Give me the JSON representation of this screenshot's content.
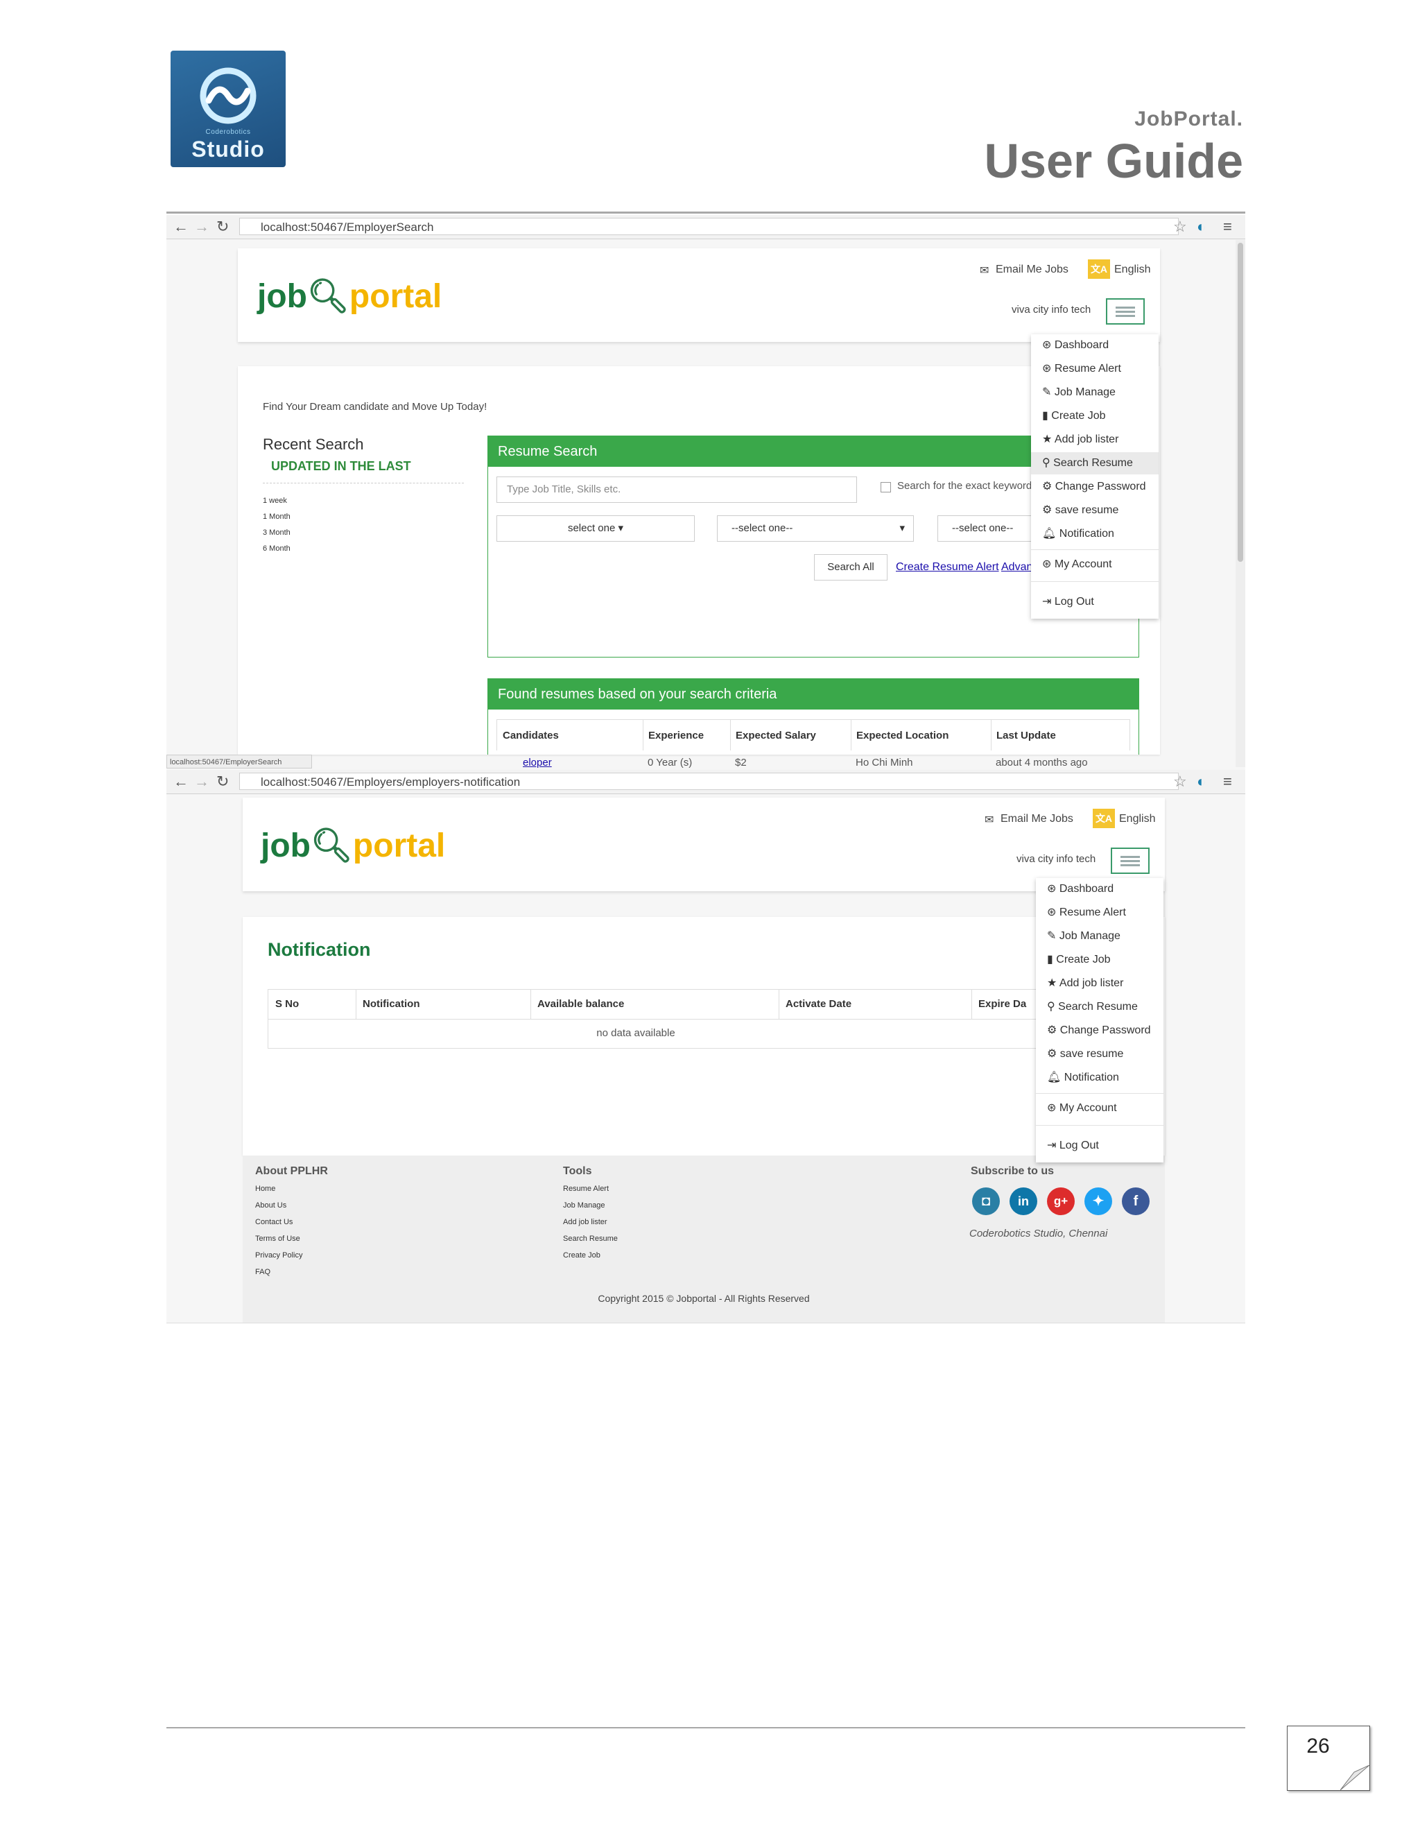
{
  "doc": {
    "logo_small_text": "Coderobotics",
    "logo_studio_text": "Studio",
    "kicker": "JobPortal.",
    "title": "User Guide",
    "page_number": "26"
  },
  "shot1": {
    "url": "localhost:50467/EmployerSearch",
    "status_url": "localhost:50467/EmployerSearch",
    "email_me_jobs": "Email Me Jobs",
    "language": "English",
    "user": "viva city info tech",
    "brand_job": "job",
    "brand_portal": "portal",
    "tagline": "Find Your Dream candidate and Move Up Today!",
    "recent_search_title": "Recent Search",
    "updated_label": "UPDATED IN THE LAST",
    "periods": [
      "1 week",
      "1 Month",
      "3 Month",
      "6 Month"
    ],
    "resume_search_title": "Resume Search",
    "search_placeholder": "Type Job Title, Skills etc.",
    "exact_keyword_label": "Search for the exact keyword",
    "select1": "select one",
    "select2": "--select one--",
    "select3": "--select one--",
    "search_all": "Search All",
    "create_alert_link": "Create Resume Alert",
    "advanced_link": "Advanced",
    "found_title": "Found resumes based on your search criteria",
    "table_headers": [
      "Candidates",
      "Experience",
      "Expected Salary",
      "Expected Location",
      "Last Update"
    ],
    "row": [
      "eloper",
      "0 Year (s)",
      "$2",
      "Ho Chi Minh",
      "about 4 months ago"
    ]
  },
  "menu": {
    "items": [
      "Dashboard",
      "Resume Alert",
      "Job Manage",
      "Create Job",
      "Add job lister",
      "Search Resume",
      "Change Password",
      "save resume",
      "Notification"
    ],
    "my_account": "My Account",
    "log_out": "Log Out",
    "active_index": 5
  },
  "shot2": {
    "url": "localhost:50467/Employers/employers-notification",
    "email_me_jobs": "Email Me Jobs",
    "language": "English",
    "user": "viva city info tech",
    "brand_job": "job",
    "brand_portal": "portal",
    "heading": "Notification",
    "table_headers": [
      "S No",
      "Notification",
      "Available balance",
      "Activate Date",
      "Expire Da"
    ],
    "empty_text": "no data available",
    "footer": {
      "about_title": "About PPLHR",
      "about_links": [
        "Home",
        "About Us",
        "Contact Us",
        "Terms of Use",
        "Privacy Policy",
        "FAQ"
      ],
      "tools_title": "Tools",
      "tools_links": [
        "Resume Alert",
        "Job Manage",
        "Add job lister",
        "Search Resume",
        "Create Job"
      ],
      "subscribe_title": "Subscribe to us",
      "company": "Coderobotics Studio, Chennai",
      "copyright": "Copyright 2015 © Jobportal - All Rights Reserved"
    }
  }
}
